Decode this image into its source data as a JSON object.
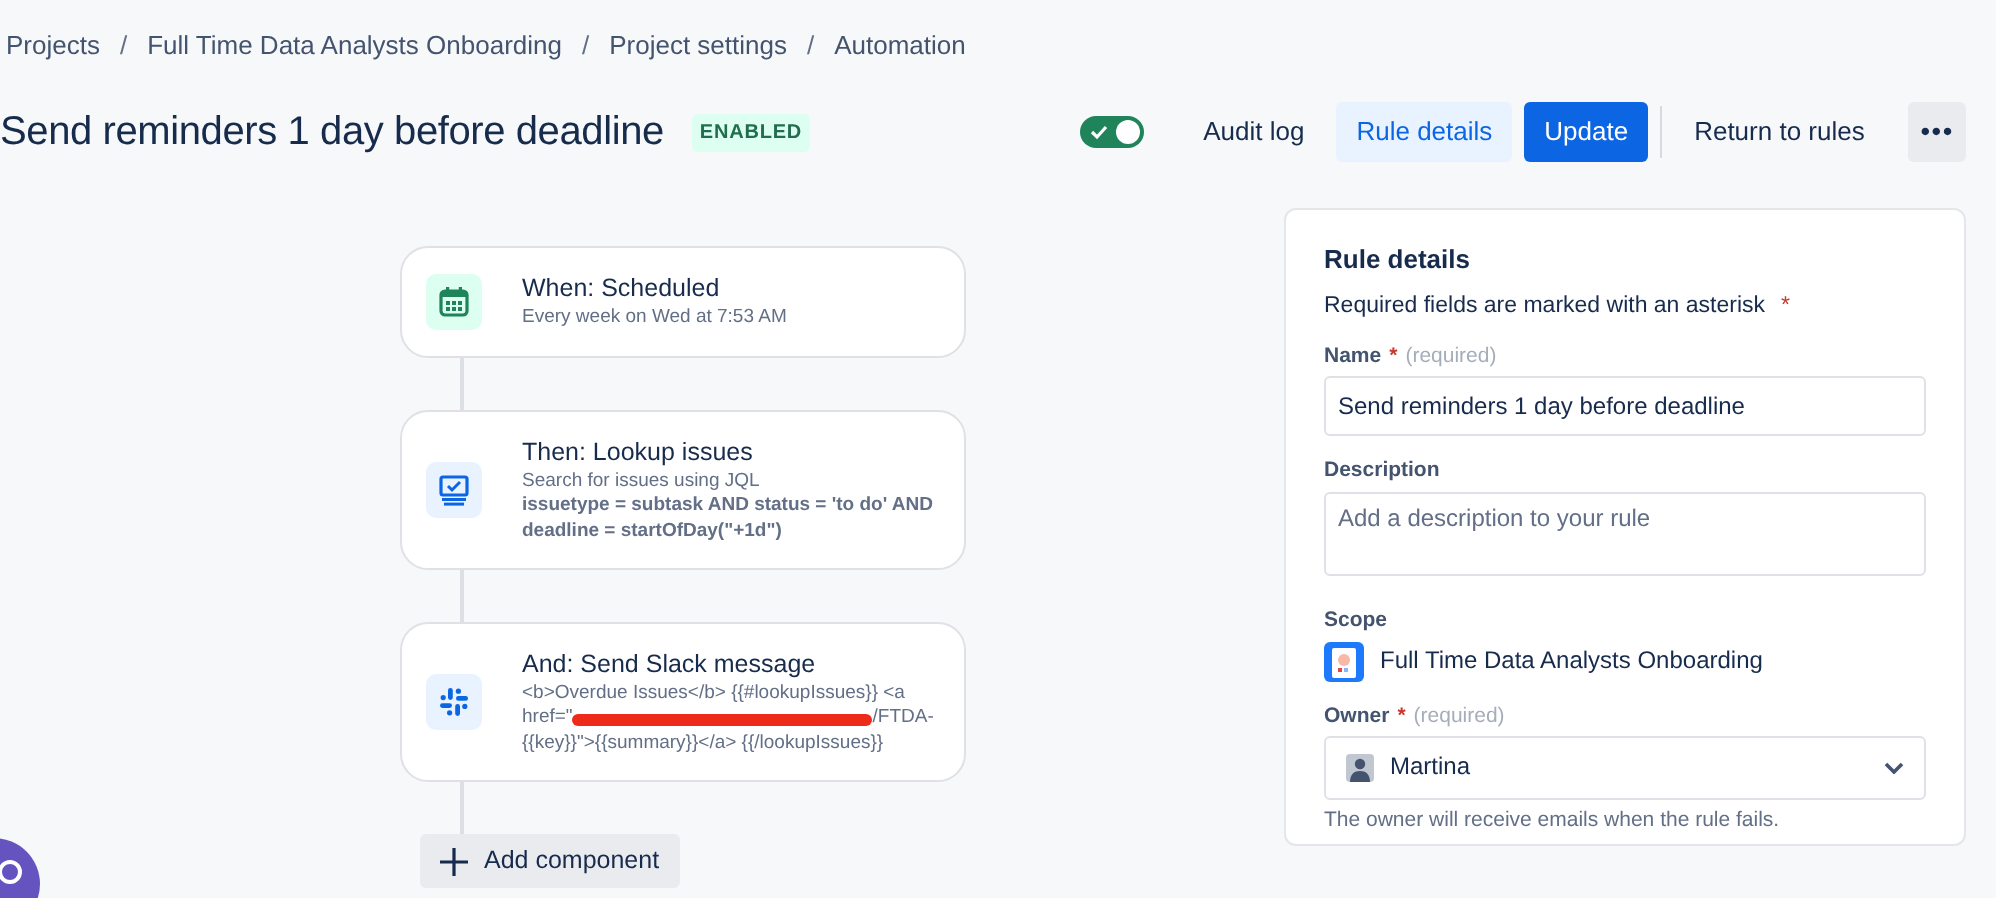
{
  "breadcrumbs": [
    {
      "label": "Projects"
    },
    {
      "label": "Full Time Data Analysts Onboarding"
    },
    {
      "label": "Project settings"
    },
    {
      "label": "Automation"
    }
  ],
  "breadcrumb_separator": "/",
  "title": "Send reminders 1 day before deadline",
  "status_badge": "ENABLED",
  "toggle": {
    "on": true
  },
  "actions": [
    {
      "label": "Audit log",
      "kind": "subtle",
      "selected": false
    },
    {
      "label": "Rule details",
      "kind": "subtle",
      "selected": true
    },
    {
      "label": "Update",
      "kind": "primary",
      "selected": false
    },
    {
      "label": "Return to rules",
      "kind": "subtle",
      "selected": false
    },
    {
      "label": "•••",
      "kind": "more",
      "selected": false
    }
  ],
  "components": [
    {
      "kind": "trigger",
      "title": "When: Scheduled",
      "lines": [
        {
          "text": "Every week on Wed at 7:53 AM",
          "bold": false
        }
      ]
    },
    {
      "kind": "lookup",
      "title": "Then: Lookup issues",
      "lines": [
        {
          "text": "Search for issues using JQL",
          "bold": false
        },
        {
          "text": "issuetype = subtask AND status = 'to do' AND deadline = startOfDay(\"+1d\")",
          "bold": true
        }
      ]
    },
    {
      "kind": "slack",
      "title": "And: Send Slack message",
      "lines": [
        {
          "text": "<b>Overdue Issues</b> {{#lookupIssues}} <a",
          "bold": false
        },
        {
          "text": "href=\"",
          "bold": false,
          "redacted_after": true
        },
        {
          "text": "/FTDA-",
          "bold": false
        },
        {
          "text": "{{key}}\">{{summary}}</a> {{/lookupIssues}}",
          "bold": false
        }
      ]
    }
  ],
  "add_component": "Add component",
  "panel": {
    "title": "Rule details",
    "required_note": "Required fields are marked with an asterisk",
    "asterisk": "*",
    "name": {
      "label": "Name",
      "required": true,
      "hint": "(required)",
      "value": "Send reminders 1 day before deadline"
    },
    "description": {
      "label": "Description",
      "placeholder": "Add a description to your rule"
    },
    "scope": {
      "label": "Scope",
      "value": "Full Time Data Analysts Onboarding"
    },
    "owner": {
      "label": "Owner",
      "required": true,
      "hint": "(required)",
      "value": "Martina",
      "help": "The owner will receive emails when the rule fails."
    }
  }
}
